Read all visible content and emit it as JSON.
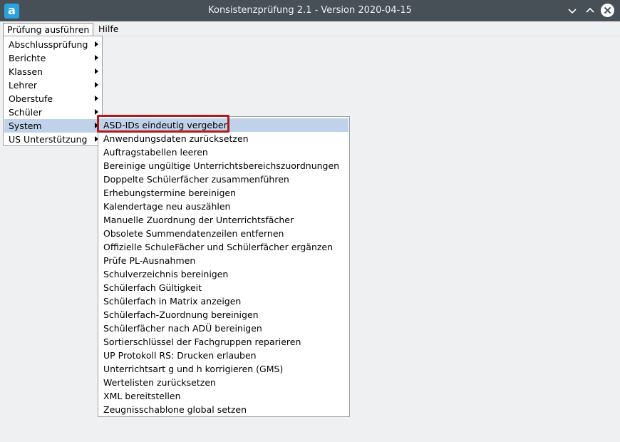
{
  "window": {
    "title": "Konsistenzprüfung 2.1 - Version 2020-04-15",
    "icon_letter": "a"
  },
  "menubar": [
    {
      "label": "Prüfung ausführen",
      "active": true
    },
    {
      "label": "Hilfe",
      "active": false
    }
  ],
  "dropdown": {
    "items": [
      {
        "label": "Abschlussprüfung",
        "hover": false
      },
      {
        "label": "Berichte",
        "hover": false
      },
      {
        "label": "Klassen",
        "hover": false
      },
      {
        "label": "Lehrer",
        "hover": false
      },
      {
        "label": "Oberstufe",
        "hover": false
      },
      {
        "label": "Schüler",
        "hover": false
      },
      {
        "label": "System",
        "hover": true
      },
      {
        "label": "US Unterstützung",
        "hover": false
      }
    ]
  },
  "submenu": {
    "items": [
      "ASD-IDs eindeutig vergeben",
      "Anwendungsdaten zurücksetzen",
      "Auftragstabellen leeren",
      "Bereinige ungültige Unterrichtsbereichszuordnungen",
      "Doppelte Schülerfächer zusammenführen",
      "Erhebungstermine bereinigen",
      "Kalendertage neu auszählen",
      "Manuelle Zuordnung der Unterrichtsfächer",
      "Obsolete Summendatenzeilen entfernen",
      "Offizielle SchuleFächer und Schülerfächer ergänzen",
      "Prüfe PL-Ausnahmen",
      "Schulverzeichnis bereinigen",
      "Schülerfach Gültigkeit",
      "Schülerfach in Matrix anzeigen",
      "Schülerfach-Zuordnung bereinigen",
      "Schülerfächer nach ADÜ bereinigen",
      "Sortierschlüssel der Fachgruppen reparieren",
      "UP Protokoll RS: Drucken erlauben",
      "Unterrichtsart g und h korrigieren (GMS)",
      "Wertelisten zurücksetzen",
      "XML bereitstellen",
      "Zeugnisschablone global setzen"
    ],
    "hover_index": 0
  },
  "colors": {
    "titlebar": "#475057",
    "menu_hover": "#bfd2ea",
    "highlight_border": "#b01b1b"
  }
}
